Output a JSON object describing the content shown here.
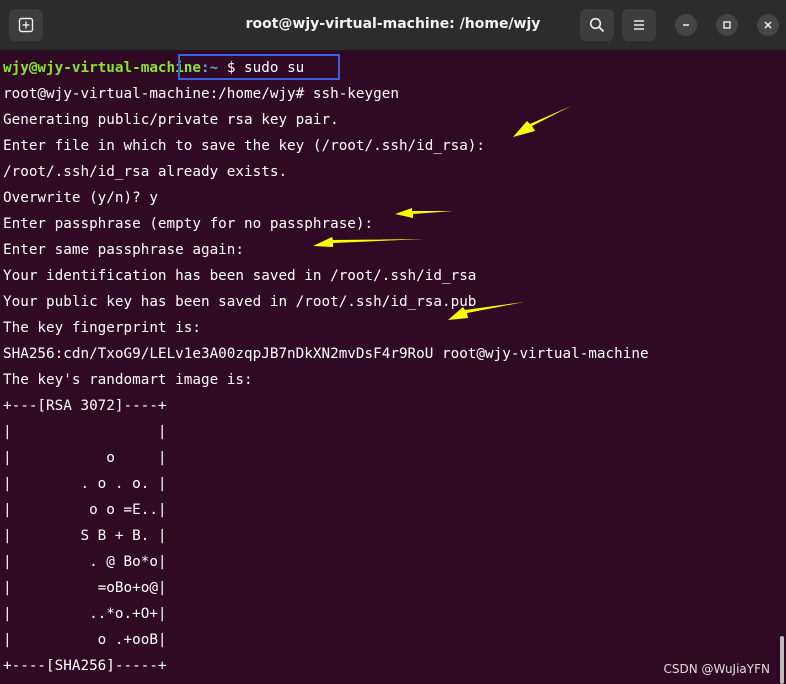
{
  "window": {
    "title": "root@wjy-virtual-machine: /home/wjy",
    "icons": [
      "new-tab-icon",
      "search-icon",
      "hamburger-menu-icon",
      "minimize-icon",
      "maximize-icon",
      "close-icon"
    ]
  },
  "terminal": {
    "prompt_user": "wjy@wjy-virtual-machine",
    "prompt_path": ":~",
    "prompt_cmd": "$ sudo su",
    "lines": [
      "root@wjy-virtual-machine:/home/wjy# ssh-keygen",
      "Generating public/private rsa key pair.",
      "Enter file in which to save the key (/root/.ssh/id_rsa):",
      "/root/.ssh/id_rsa already exists.",
      "Overwrite (y/n)? y",
      "Enter passphrase (empty for no passphrase):",
      "Enter same passphrase again:",
      "Your identification has been saved in /root/.ssh/id_rsa",
      "Your public key has been saved in /root/.ssh/id_rsa.pub",
      "The key fingerprint is:",
      "SHA256:cdn/TxoG9/LELv1e3A00zqpJB7nDkXN2mvDsF4r9RoU root@wjy-virtual-machine",
      "The key's randomart image is:",
      "+---[RSA 3072]----+",
      "|                 |",
      "|           o     |",
      "|        . o . o. |",
      "|         o o =E..|",
      "|        S B + B. |",
      "|         . @ Bo*o|",
      "|          =oBo+o@|",
      "|         ..*o.+O+|",
      "|          o .+ooB|",
      "+----[SHA256]-----+"
    ]
  },
  "annotation_color": "#ffff00",
  "highlight_color": "#3c5fe0",
  "watermark": "CSDN @WuJiaYFN"
}
